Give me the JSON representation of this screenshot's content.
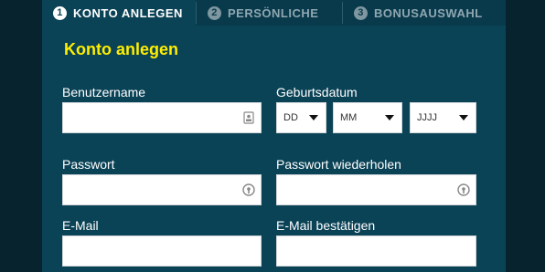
{
  "steps": [
    {
      "number": "1",
      "label": "KONTO ANLEGEN"
    },
    {
      "number": "2",
      "label": "PERSÖNLICHE"
    },
    {
      "number": "3",
      "label": "BONUSAUSWAHL"
    }
  ],
  "form": {
    "title": "Konto anlegen",
    "username": {
      "label": "Benutzername",
      "value": ""
    },
    "birthdate": {
      "label": "Geburtsdatum",
      "day": "DD",
      "month": "MM",
      "year": "JJJJ"
    },
    "password": {
      "label": "Passwort",
      "value": ""
    },
    "password_repeat": {
      "label": "Passwort wiederholen",
      "value": ""
    },
    "email": {
      "label": "E-Mail",
      "value": ""
    },
    "email_confirm": {
      "label": "E-Mail bestätigen",
      "value": ""
    }
  },
  "colors": {
    "background": "#07232e",
    "panel": "#0a4256",
    "title": "#ffee00",
    "label": "#ffffff"
  }
}
